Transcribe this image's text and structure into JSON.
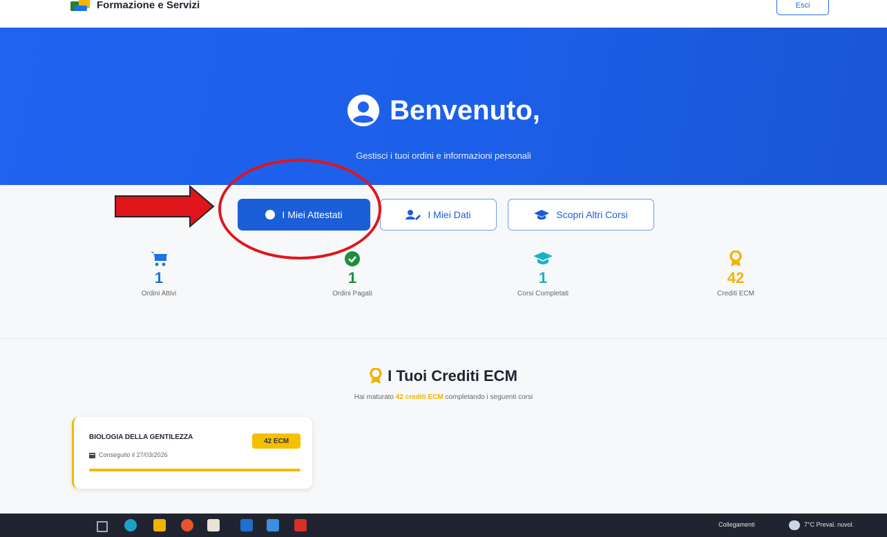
{
  "brand": {
    "name": "Formazione e Servizi"
  },
  "header": {
    "button_label": "Esci"
  },
  "hero": {
    "title": "Benvenuto,",
    "subtitle": "Gestisci i tuoi ordini e informazioni personali",
    "background_color": "#1f63f0"
  },
  "tabs": [
    {
      "label": "I Miei Attestati",
      "icon": "circle-icon",
      "active": true
    },
    {
      "label": "I Miei Dati",
      "icon": "user-edit-icon",
      "active": false
    },
    {
      "label": "Scopri Altri Corsi",
      "icon": "graduation-cap-icon",
      "active": false
    }
  ],
  "stats": [
    {
      "value": "1",
      "label": "Ordini Attivi",
      "icon": "cart-icon",
      "color": "#1a73e8"
    },
    {
      "value": "1",
      "label": "Ordini Pagati",
      "icon": "check-circle-icon",
      "color": "#1e8e3e"
    },
    {
      "value": "1",
      "label": "Corsi Completati",
      "icon": "graduation-cap-icon",
      "color": "#17b3c4"
    },
    {
      "value": "42",
      "label": "Crediti ECM",
      "icon": "award-icon",
      "color": "#f2b400"
    }
  ],
  "ecm": {
    "title": "I Tuoi Crediti ECM",
    "subtitle_pre": "Hai maturato ",
    "subtitle_highlight": "42 crediti ECM",
    "subtitle_post": " completando i seguenti corsi"
  },
  "courses": [
    {
      "title": "BIOLOGIA DELLA GENTILEZZA",
      "badge": "42 ECM",
      "date_text": "Conseguito il 27/03/2026",
      "progress": 1.0
    }
  ],
  "taskbar": {
    "links_label": "Collegamenti",
    "weather": "7°C Preval. nuvol."
  },
  "annotation": {
    "color": "#e0151c"
  }
}
